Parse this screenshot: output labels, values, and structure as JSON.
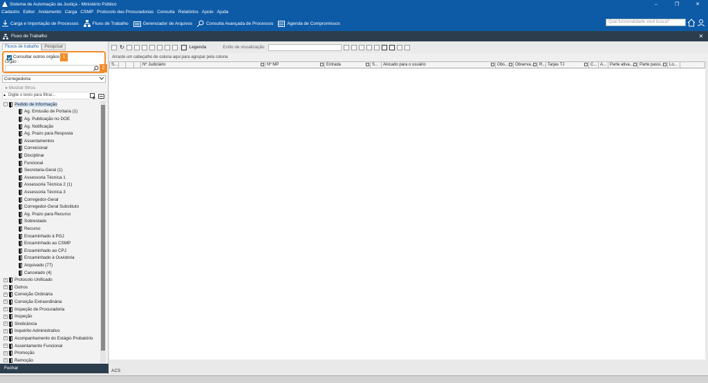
{
  "window": {
    "title": "Sistema de Automação da Justiça - Ministério Público",
    "controls": [
      "–",
      "❐",
      "✕"
    ]
  },
  "menubar": [
    "Cadastro",
    "Editor",
    "Andamento",
    "Carga",
    "CSMP",
    "Protocolo das Procuradorias",
    "Consulta",
    "Relatórios",
    "Apoio",
    "Ajuda"
  ],
  "toolbar": [
    {
      "label": "Carga e Importação de Processos",
      "icon": "download-icon"
    },
    {
      "label": "Fluxo de Trabalho",
      "icon": "flow-icon"
    },
    {
      "label": "Gerenciador de Arquivos",
      "icon": "folder-icon"
    },
    {
      "label": "Consulta Avançada de Processos",
      "icon": "search-icon"
    },
    {
      "label": "Agenda de Compromissos",
      "icon": "calendar-icon"
    }
  ],
  "search": {
    "placeholder": "Qual funcionalidade você busca?"
  },
  "inner": {
    "title": "Fluxo de Trabalho",
    "close": "✕"
  },
  "left": {
    "tabs": [
      "Fluxos de trabalho",
      "Pesquisar"
    ],
    "consultar_label": "Consultar outros orgãos",
    "orgao_label": "Órgão :",
    "badge1": "1",
    "badge2": "2",
    "corregedoria": "Corregedoria",
    "mostrar_filtros": "Mostrar filtros",
    "filter_placeholder": "Digite o texto para filtrar...",
    "root": "Pedido de Informação",
    "children": [
      "Ag. Emissão de Portaria (1)",
      "Ag. Publicação no DOE",
      "Ag. Notificação",
      "Ag. Prazo para Resposta",
      "Assentamentos",
      "Correicional",
      "Disciplinar",
      "Funcional",
      "Secretaria-Geral (1)",
      "Assessoria Técnica 1",
      "Assessoria Técnica 2 (1)",
      "Assessoria Técnica 3",
      "Corregedor-Geral",
      "Corregedor-Geral Substituto",
      "Ag. Prazo para Recurso",
      "Sobrestado",
      "Recurso",
      "Encaminhado à PGJ",
      "Encaminhado ao CSMP",
      "Encaminhado ao CPJ",
      "Encaminhado à Ouvidoria",
      "Arquivado (77)",
      "Cancelado (4)"
    ],
    "others": [
      "Protocolo Unificado",
      "Outros",
      "Correição Ordinária",
      "Correição Extraordinária",
      "Inspeção de Procuradoria",
      "Inspeção",
      "Sindicância",
      "Inquérito Administrativo",
      "Acompanhamento do Estágio Probatório",
      "Assentamento Funcional",
      "Promoção",
      "Remoção"
    ],
    "fechar": "Fechar"
  },
  "right": {
    "legenda": "Legenda",
    "estilo": "Estilo de visualização",
    "groupbar": "Arraste um cabeçalho de coluna aqui para agrupar pela coluna",
    "columns": [
      "S...",
      "",
      "",
      "",
      "Nº Judiciário",
      "Nº MP",
      "Entrada",
      "S...",
      "Alocado para o usuário",
      "Obs...",
      "Observa...",
      "R...",
      "Tarjas TJ",
      "C...",
      "A...",
      "Parte ativa...",
      "Parte passi...",
      "Lo..."
    ],
    "status": "ACS"
  }
}
